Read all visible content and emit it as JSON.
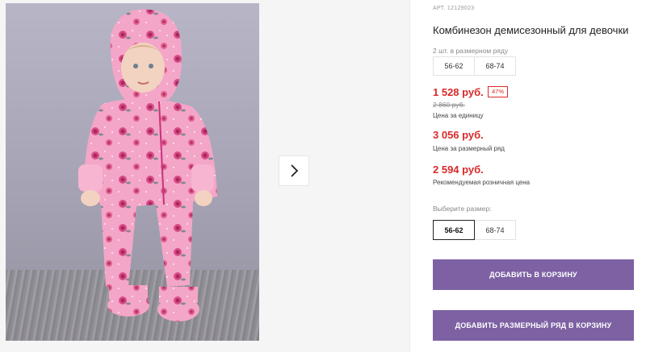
{
  "product": {
    "article": "АРТ. 12129023",
    "title": "Комбинезон демисезонный для девочки",
    "set_label": "2 шт. в размерном ряду",
    "set_sizes": [
      "56-62",
      "68-74"
    ],
    "price": "1 528 руб.",
    "discount_badge": "47%",
    "old_price": "2 860 руб.",
    "price_caption": "Цена за единицу",
    "set_price": "3 056 руб.",
    "set_price_caption": "Цена за размерный ряд",
    "retail_price": "2 594 руб.",
    "retail_caption": "Рекомендуемая розничная цена",
    "choose_size_label": "Выберите размер:",
    "sizes": [
      "56-62",
      "68-74"
    ],
    "selected_size": "56-62"
  },
  "actions": {
    "add_to_cart": "ДОБАВИТЬ В КОРЗИНУ",
    "add_set_to_cart": "ДОБАВИТЬ РАЗМЕРНЫЙ РЯД В КОРЗИНУ"
  },
  "gallery": {
    "next_icon": "chevron-right-icon"
  },
  "colors": {
    "price_red": "#d92a2a",
    "button_purple": "#7d61a3",
    "suit_pink": "#f4a6c8"
  }
}
